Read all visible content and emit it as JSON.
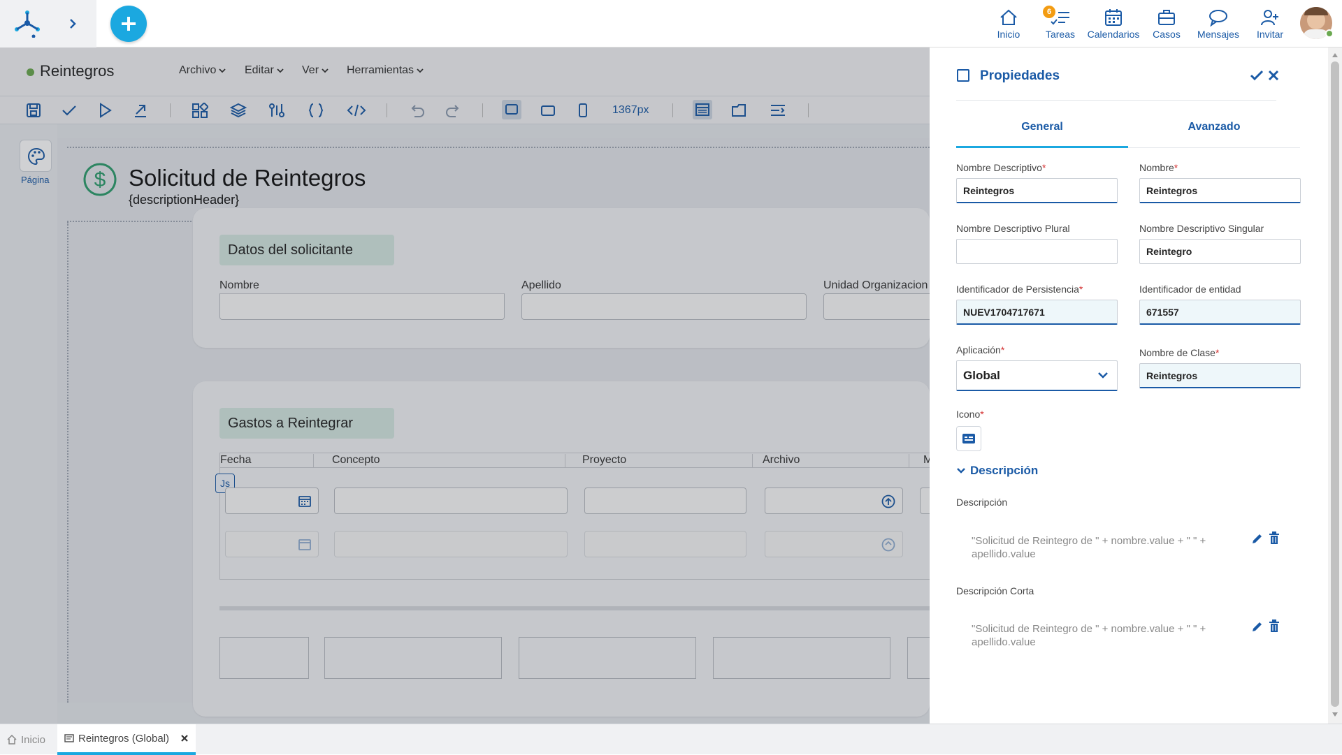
{
  "topnav": {
    "items": [
      {
        "label": "Inicio",
        "icon": "home-icon"
      },
      {
        "label": "Tareas",
        "icon": "tasks-icon",
        "badge": "6"
      },
      {
        "label": "Calendarios",
        "icon": "calendar-icon"
      },
      {
        "label": "Casos",
        "icon": "briefcase-icon"
      },
      {
        "label": "Mensajes",
        "icon": "chat-icon"
      },
      {
        "label": "Invitar",
        "icon": "invite-icon"
      }
    ],
    "accent": "#1a5aa6",
    "plus_color": "#1ba8e0"
  },
  "header": {
    "title": "Reintegros",
    "status_color": "#6aa84f",
    "menus": [
      "Archivo",
      "Editar",
      "Ver",
      "Herramientas"
    ]
  },
  "toolbar": {
    "width_label": "1367px"
  },
  "leftrail": {
    "page_label": "Página"
  },
  "form": {
    "title": "Solicitud de Reintegros",
    "subtitle": "{descriptionHeader}",
    "section1": {
      "title": "Datos del solicitante",
      "fields": [
        "Nombre",
        "Apellido",
        "Unidad Organizacion"
      ]
    },
    "section2": {
      "title": "Gastos a Reintegrar",
      "columns": [
        "Fecha",
        "Concepto",
        "Proyecto",
        "Archivo",
        "M"
      ],
      "js_badge": "Js"
    }
  },
  "panel": {
    "title": "Propiedades",
    "tabs": [
      {
        "label": "General",
        "active": true
      },
      {
        "label": "Avanzado",
        "active": false
      }
    ],
    "fields": {
      "nombre_descriptivo": {
        "label": "Nombre Descriptivo",
        "value": "Reintegros",
        "required": "*"
      },
      "nombre": {
        "label": "Nombre",
        "value": "Reintegros",
        "required": "*"
      },
      "plural": {
        "label": "Nombre Descriptivo Plural",
        "value": ""
      },
      "singular": {
        "label": "Nombre Descriptivo Singular",
        "value": "Reintegro"
      },
      "persistencia": {
        "label": "Identificador de Persistencia",
        "value": "NUEV1704717671",
        "required": "*"
      },
      "entidad": {
        "label": "Identificador de entidad",
        "value": "671557"
      },
      "aplicacion": {
        "label": "Aplicación",
        "value": "Global",
        "required": "*"
      },
      "clase": {
        "label": "Nombre de Clase",
        "value": "Reintegros",
        "required": "*"
      },
      "icono": {
        "label": "Icono",
        "required": "*"
      }
    },
    "description_section": {
      "title": "Descripción",
      "descripcion_label": "Descripción",
      "descripcion_value": "\"Solicitud de Reintegro de \" + nombre.value + \" \" + apellido.value",
      "corta_label": "Descripción Corta",
      "corta_value": "\"Solicitud de Reintegro de \" + nombre.value + \" \" + apellido.value"
    }
  },
  "bottomtabs": [
    {
      "label": "Inicio",
      "active": false
    },
    {
      "label": "Reintegros (Global)",
      "active": true
    }
  ]
}
